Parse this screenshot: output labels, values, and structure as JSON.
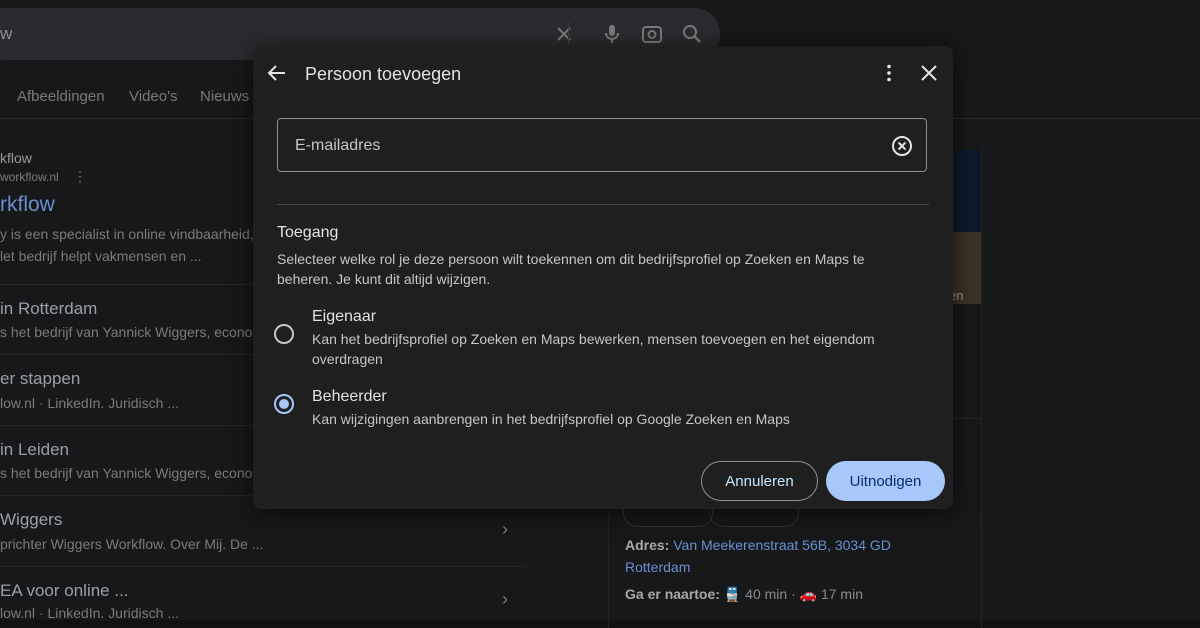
{
  "background": {
    "search_query": "w",
    "tabs": [
      "Afbeeldingen",
      "Video's",
      "Nieuws"
    ],
    "results": {
      "site_name": "kflow",
      "site_url": "workflow.nl",
      "title": "rkflow",
      "snippet_1": "y is een specialist in online vindbaarheid, ...",
      "snippet_2": "let bedrijf helpt vakmensen en ...",
      "items": [
        {
          "title": "in Rotterdam",
          "snippet": "s het bedrijf van Yannick Wiggers, econo..."
        },
        {
          "title": "er stappen",
          "snippet": "low.nl · LinkedIn. Juridisch ..."
        },
        {
          "title": "in Leiden",
          "snippet": "s het bedrijf van Yannick Wiggers, econo..."
        },
        {
          "title": "Wiggers",
          "snippet": "prichter Wiggers Workflow. Over Mij. De ..."
        },
        {
          "title": "EA voor online ...",
          "snippet": "low.nl · LinkedIn. Juridisch ..."
        }
      ]
    },
    "knowledge_panel": {
      "image_label": "en",
      "address_label": "Adres:",
      "address_value": "Van Meekerenstraat 56B, 3034 GD Rotterdam",
      "travel_label": "Ga er naartoe:",
      "travel_transit": "40 min",
      "travel_car": "17 min"
    }
  },
  "dialog": {
    "title": "Persoon toevoegen",
    "email_placeholder": "E-mailadres",
    "access_title": "Toegang",
    "access_description": "Selecteer welke rol je deze persoon wilt toekennen om dit bedrijfsprofiel op Zoeken en Maps te beheren. Je kunt dit altijd wijzigen.",
    "roles": [
      {
        "title": "Eigenaar",
        "description": "Kan het bedrijfsprofiel op Zoeken en Maps bewerken, mensen toevoegen en het eigendom overdragen",
        "selected": false
      },
      {
        "title": "Beheerder",
        "description": "Kan wijzigingen aanbrengen in het bedrijfsprofiel op Google Zoeken en Maps",
        "selected": true
      }
    ],
    "cancel_label": "Annuleren",
    "invite_label": "Uitnodigen"
  },
  "colors": {
    "dialog_bg": "#1f1f1f",
    "primary_button": "#a8c7fa",
    "radio_selected": "#a8c7fa",
    "link_blue": "#6a8fd1"
  }
}
